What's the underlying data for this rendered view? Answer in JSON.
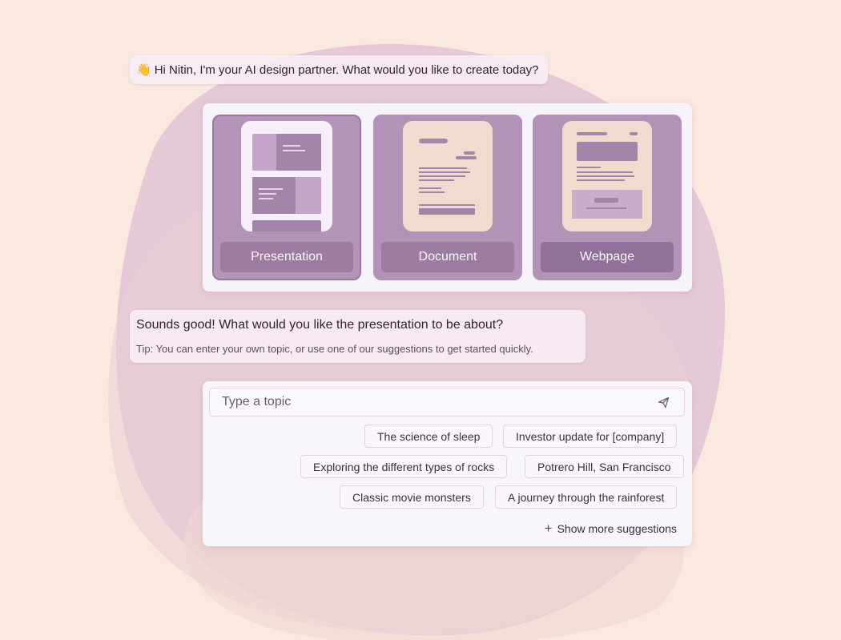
{
  "greeting": {
    "emoji": "👋",
    "text": "Hi Nitin, I'm your AI design partner. What would you like to create today?"
  },
  "content_types": [
    {
      "label": "Presentation",
      "selected": true
    },
    {
      "label": "Document",
      "selected": false
    },
    {
      "label": "Webpage",
      "selected": false
    }
  ],
  "prompt": {
    "question": "Sounds good! What would you like the presentation to be about?",
    "tip": "Tip: You can enter your own topic, or use one of our suggestions to get started quickly."
  },
  "topic_input": {
    "placeholder": "Type a topic",
    "value": "",
    "send_icon": "paper-plane-icon"
  },
  "suggestions": [
    "The science of sleep",
    "Investor update for [company]",
    "Exploring the different types of rocks",
    "Potrero Hill, San Francisco",
    "Classic movie monsters",
    "A journey through the rainforest"
  ],
  "show_more": {
    "icon": "plus-icon",
    "label": "Show more suggestions"
  },
  "colors": {
    "background": "#fae9df",
    "blob": "#dcb9d0",
    "accent": "#9e7ba1",
    "panel": "#f8f5fc"
  }
}
